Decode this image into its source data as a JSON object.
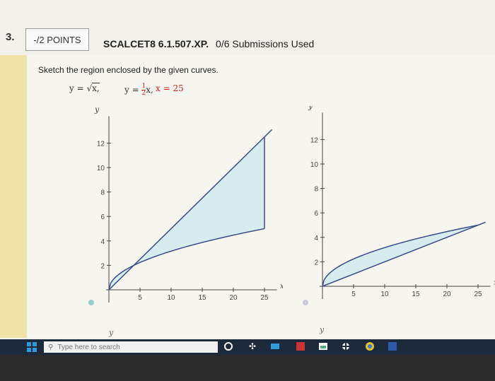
{
  "question": {
    "number": "3.",
    "points": "-/2 POINTS",
    "code": "SCALCET8 6.1.507.XP.",
    "submissions": "0/6 Submissions Used",
    "prompt": "Sketch the region enclosed by the given curves."
  },
  "equations": {
    "eq1_lhs": "y = ",
    "eq1_rad": "x,",
    "eq2_lhs": "y = ",
    "eq2_num": "1",
    "eq2_den": "2",
    "eq2_rhs": "x,",
    "eq3": "x = 25"
  },
  "graphs": [
    {
      "ylabel": "y",
      "xlabel": "x",
      "yticks": [
        "12",
        "10",
        "8",
        "6",
        "4",
        "2"
      ],
      "xticks": [
        "5",
        "10",
        "15",
        "20",
        "25"
      ]
    },
    {
      "ylabel": "y",
      "xlabel": "x",
      "yticks": [
        "12",
        "10",
        "8",
        "6",
        "4",
        "2"
      ],
      "xticks": [
        "5",
        "10",
        "15",
        "20",
        "25"
      ]
    }
  ],
  "partial_graph": {
    "ylabel_left": "y",
    "ylabel_right": "y"
  },
  "taskbar": {
    "search_placeholder": "Type here to search"
  },
  "colors": {
    "accent_bar": "#efe4a8",
    "region_fill": "#d6ecee",
    "taskbar": "#1c2a3c"
  },
  "chart_data": [
    {
      "type": "area",
      "title": "",
      "xlabel": "x",
      "ylabel": "y",
      "xlim": [
        0,
        27
      ],
      "ylim": [
        0,
        14
      ],
      "series": [
        {
          "values_x": [
            0,
            25
          ],
          "values_y": [
            0,
            12.5
          ]
        },
        {
          "values_x": [
            0,
            1,
            4,
            9,
            16,
            25
          ],
          "values_y": [
            0,
            1,
            2,
            3,
            4,
            5
          ]
        }
      ]
    },
    {
      "type": "area",
      "title": "",
      "xlabel": "x",
      "ylabel": "y",
      "xlim": [
        0,
        27
      ],
      "ylim": [
        0,
        14
      ],
      "series": [
        {
          "values_x": [
            0,
            25
          ],
          "values_y": [
            0,
            5
          ]
        },
        {
          "values_x": [
            0,
            1,
            4,
            9,
            16,
            25
          ],
          "values_y": [
            0,
            1,
            2,
            3,
            4,
            5
          ]
        }
      ]
    }
  ]
}
